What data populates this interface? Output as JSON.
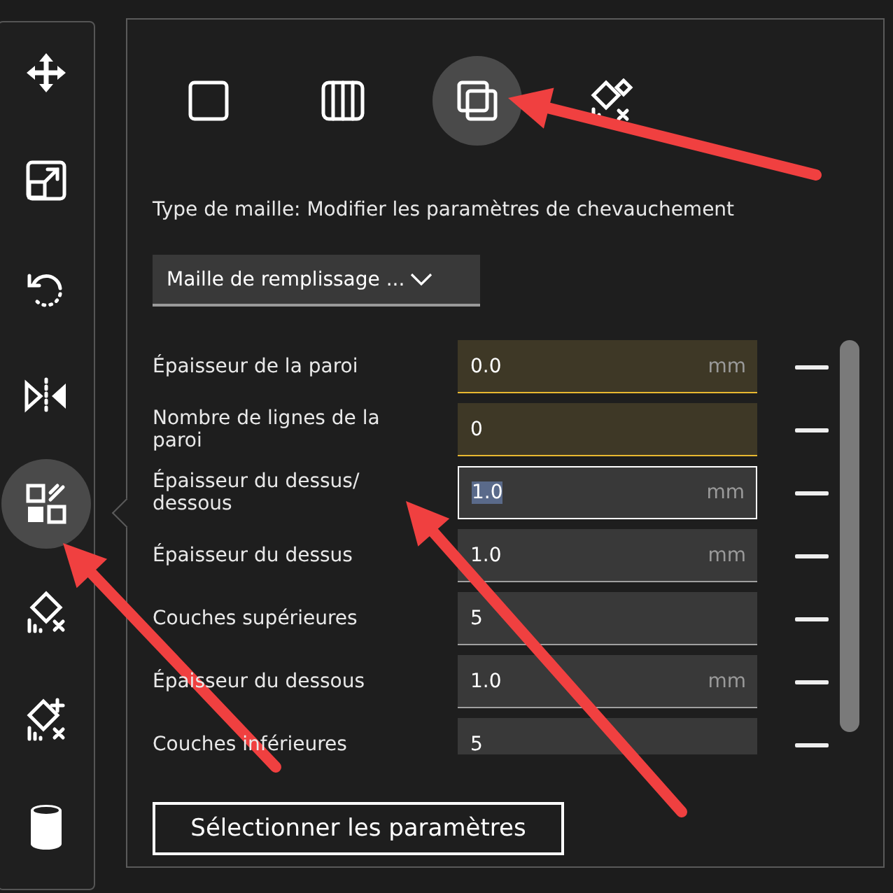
{
  "toolbar": {
    "tools": [
      {
        "kind": "move",
        "selected": false
      },
      {
        "kind": "scale",
        "selected": false
      },
      {
        "kind": "rotate",
        "selected": false
      },
      {
        "kind": "mirror",
        "selected": false
      },
      {
        "kind": "per-model",
        "selected": true
      },
      {
        "kind": "support-blocker",
        "selected": false
      },
      {
        "kind": "support-eraser",
        "selected": false
      },
      {
        "kind": "cylinder",
        "selected": false
      }
    ]
  },
  "panel": {
    "mesh_types": [
      {
        "kind": "normal",
        "selected": false
      },
      {
        "kind": "infill",
        "selected": false
      },
      {
        "kind": "overlap",
        "selected": true
      },
      {
        "kind": "no-support",
        "selected": false
      }
    ],
    "mesh_type_label": "Type de maille: Modifier les paramètres de chevauchement",
    "dropdown": {
      "value": "Maille de remplissage ..."
    },
    "settings": [
      {
        "label": "Épaisseur de la paroi",
        "value": "0.0",
        "unit": "mm",
        "modified": true,
        "focused": false
      },
      {
        "label": "Nombre de lignes de la paroi",
        "value": "0",
        "modified": true,
        "focused": false
      },
      {
        "label": "Épaisseur du dessus/ dessous",
        "value": "1.0",
        "unit": "mm",
        "modified": false,
        "focused": true
      },
      {
        "label": "Épaisseur du dessus",
        "value": "1.0",
        "unit": "mm",
        "modified": false,
        "focused": false
      },
      {
        "label": "Couches supérieures",
        "value": "5",
        "modified": false,
        "focused": false
      },
      {
        "label": "Épaisseur du dessous",
        "value": "1.0",
        "unit": "mm",
        "modified": false,
        "focused": false
      },
      {
        "label": "Couches inférieures",
        "value": "5",
        "modified": false,
        "focused": false
      }
    ],
    "select_button": "Sélectionner les paramètres"
  }
}
